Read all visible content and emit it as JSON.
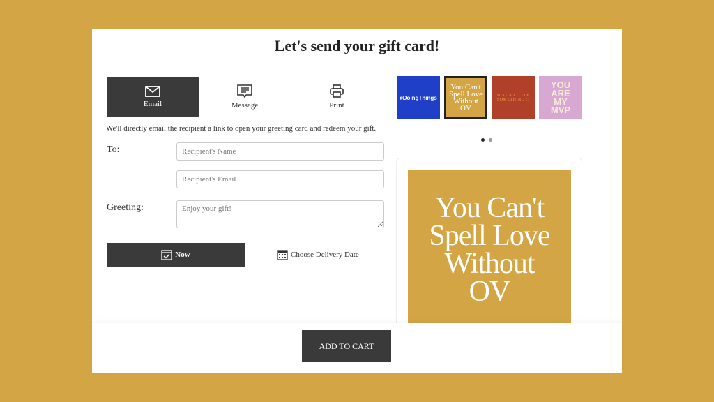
{
  "page": {
    "title": "Let's send your gift card!"
  },
  "tabs": [
    {
      "label": "Email",
      "icon": "envelope-icon",
      "active": true
    },
    {
      "label": "Message",
      "icon": "message-icon",
      "active": false
    },
    {
      "label": "Print",
      "icon": "printer-icon",
      "active": false
    }
  ],
  "description": "We'll directly email the recipient a link to open your greeting card and redeem your gift.",
  "form": {
    "to_label": "To:",
    "name_placeholder": "Recipient's Name",
    "email_placeholder": "Recipient's Email",
    "greeting_label": "Greeting:",
    "greeting_placeholder": "Enjoy your gift!"
  },
  "delivery": {
    "now_label": "Now",
    "choose_date_label": "Choose Delivery Date"
  },
  "designs": [
    {
      "text": "#DoingThings",
      "color": "#1f3fc9"
    },
    {
      "text": "You Can't Spell Love Without OV",
      "color": "#d4a545",
      "selected": true
    },
    {
      "text": "Just a little something :)",
      "color": "#b0402a"
    },
    {
      "text": "YOU ARE MY MVP",
      "color": "#d8a8d2"
    }
  ],
  "carousel": {
    "pages": 2,
    "current": 1
  },
  "preview": {
    "line1": "You Can't",
    "line2": "Spell Love",
    "line3": "Without",
    "line4": "OV"
  },
  "cart": {
    "label": "ADD TO CART"
  }
}
